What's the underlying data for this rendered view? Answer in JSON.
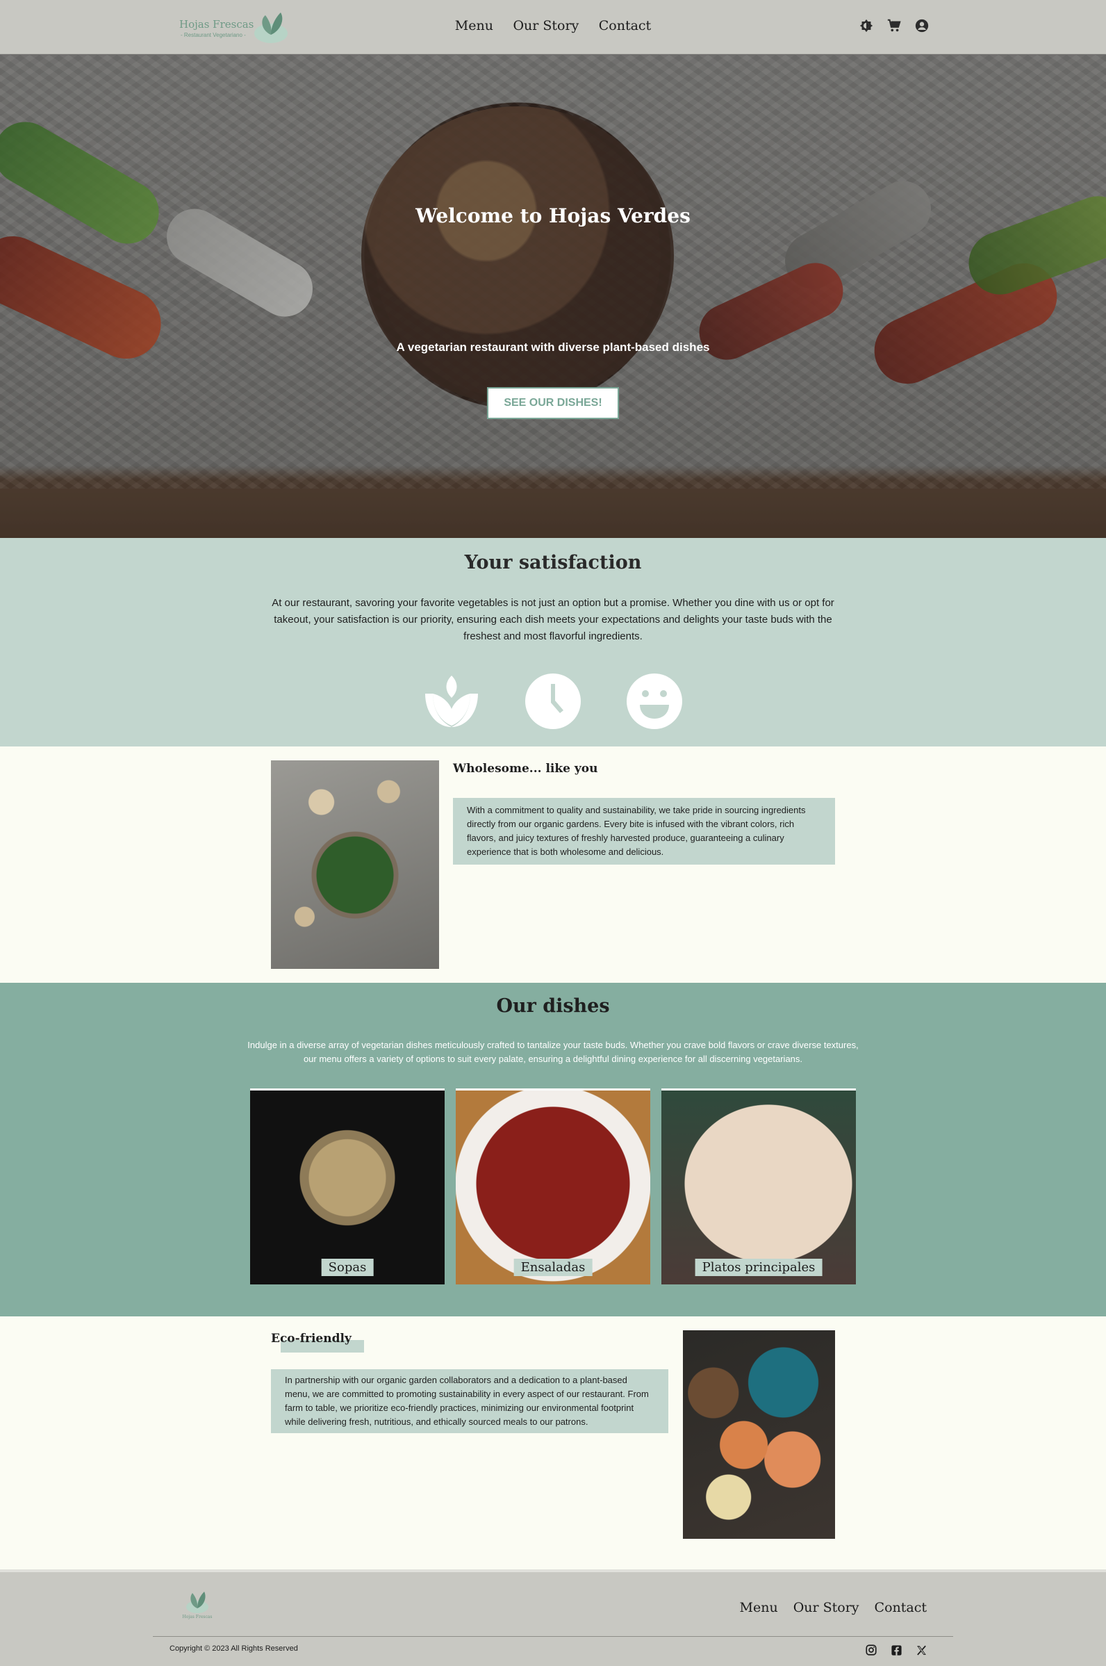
{
  "header": {
    "logo_text": "Hojas Frescas",
    "logo_sub": "- Restaurant Vegetariano -",
    "nav": [
      "Menu",
      "Our Story",
      "Contact"
    ],
    "icons": [
      "theme-toggle-icon",
      "cart-icon",
      "account-icon"
    ]
  },
  "hero": {
    "title": "Welcome to Hojas Verdes",
    "subtitle": "A vegetarian restaurant with diverse plant-based dishes",
    "button": "SEE OUR DISHES!"
  },
  "satisfaction": {
    "title": "Your satisfaction",
    "text": "At our restaurant, savoring your favorite vegetables is not just an option but a promise. Whether you dine with us or opt for takeout, your satisfaction is our priority, ensuring each dish meets your expectations and delights your taste buds with the freshest and most flavorful ingredients.",
    "icons": [
      "leaf-icon",
      "clock-icon",
      "smile-icon"
    ]
  },
  "wholesome": {
    "title": "Wholesome... like you",
    "text": "With a commitment to quality and sustainability, we take pride in sourcing ingredients directly from our organic gardens. Every bite is infused with the vibrant colors, rich flavors, and juicy textures of freshly harvested produce, guaranteeing a culinary experience that is both wholesome and delicious."
  },
  "dishes": {
    "title": "Our dishes",
    "text": "Indulge in a diverse array of vegetarian dishes meticulously crafted to tantalize your taste buds. Whether you crave bold flavors or crave diverse textures, our menu offers a variety of options to suit every palate, ensuring a delightful dining experience for all discerning vegetarians.",
    "cards": [
      {
        "label": "Sopas"
      },
      {
        "label": "Ensaladas"
      },
      {
        "label": "Platos principales"
      }
    ]
  },
  "eco": {
    "title": "Eco-friendly",
    "text": "In partnership with our organic garden collaborators and a dedication to a plant-based menu, we are committed to promoting sustainability in every aspect of our restaurant. From farm to table, we prioritize eco-friendly practices, minimizing our environmental footprint while delivering fresh, nutritious, and ethically sourced meals to our patrons."
  },
  "footer": {
    "logo_text": "Hojas Frescas",
    "nav": [
      "Menu",
      "Our Story",
      "Contact"
    ],
    "copyright": "Copyright © 2023 All Rights Reserved",
    "social": [
      "instagram-icon",
      "facebook-icon",
      "x-icon"
    ]
  },
  "colors": {
    "header_bg": "#c8c8c2",
    "mint": "#c2d6ce",
    "sage": "#85aea0",
    "cream": "#fbfcf3",
    "accent": "#7aa797"
  }
}
